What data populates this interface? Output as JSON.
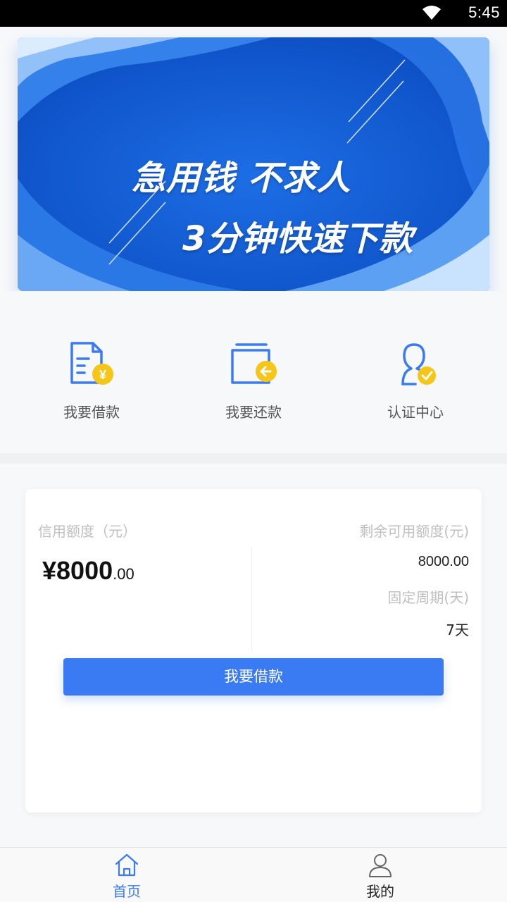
{
  "status_bar": {
    "time": "5:45",
    "wifi_icon": "wifi-icon"
  },
  "banner": {
    "line1": "急用钱 不求人",
    "line2": "3分钟快速下款"
  },
  "quick_actions": [
    {
      "label": "我要借款",
      "icon": "loan-document-icon"
    },
    {
      "label": "我要还款",
      "icon": "repay-wallet-icon"
    },
    {
      "label": "认证中心",
      "icon": "verified-user-icon"
    }
  ],
  "credit_card": {
    "credit_label": "信用额度（元）",
    "currency_symbol": "¥",
    "amount_integer": "8000",
    "amount_decimal": ".00",
    "remaining_label": "剩余可用额度(元)",
    "remaining_value": "8000.00",
    "period_label": "固定周期(天)",
    "period_value": "7天",
    "borrow_button": "我要借款"
  },
  "bottom_nav": [
    {
      "label": "首页",
      "icon": "home-icon",
      "active": true
    },
    {
      "label": "我的",
      "icon": "user-icon",
      "active": false
    }
  ],
  "colors": {
    "accent": "#3a7af2",
    "icon_yellow": "#f5c518",
    "banner_blue": "#1a63d6"
  }
}
